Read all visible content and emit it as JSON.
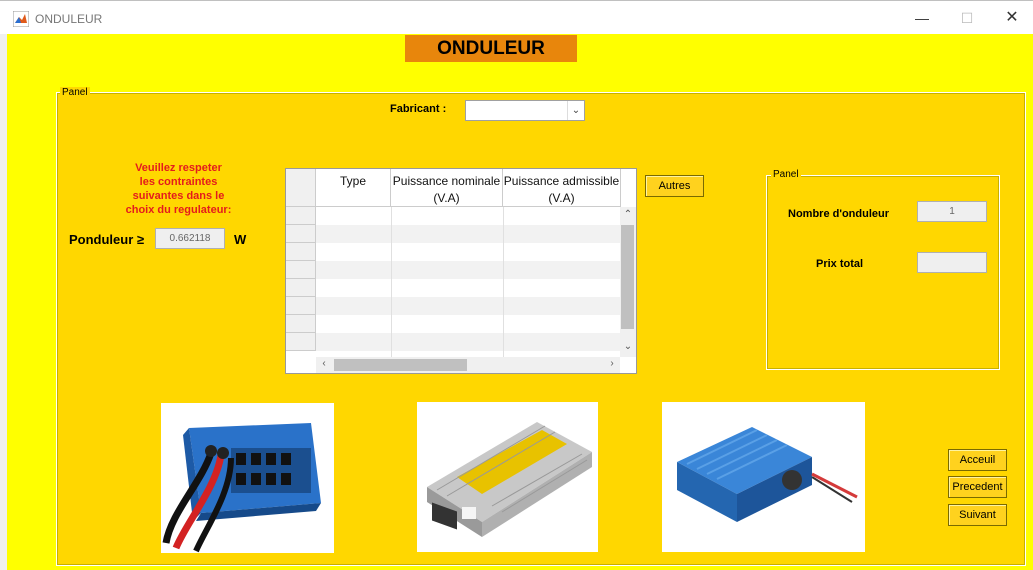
{
  "window": {
    "title": "ONDULEUR",
    "minimize": "—",
    "maximize": "☐",
    "close": "✕"
  },
  "header": {
    "title": "ONDULEUR"
  },
  "main_panel": {
    "title": "Panel"
  },
  "fabricant": {
    "label": "Fabricant :",
    "value": ""
  },
  "warning": {
    "line1": "Veuillez respeter",
    "line2": "les contraintes",
    "line3": "suivantes dans le",
    "line4": "choix du regulateur:"
  },
  "ponduleur": {
    "label": "Ponduleur ≥",
    "value": "0.662118",
    "unit": "W"
  },
  "table": {
    "columns": [
      {
        "line1": "Type",
        "line2": ""
      },
      {
        "line1": "Puissance nominale",
        "line2": "(V.A)"
      },
      {
        "line1": "Puissance admissible",
        "line2": "(V.A)"
      }
    ]
  },
  "buttons": {
    "autres": "Autres",
    "acceuil": "Acceuil",
    "precedent": "Precedent",
    "suivant": "Suivant"
  },
  "sub_panel": {
    "title": "Panel",
    "nombre_label": "Nombre d'onduleur",
    "nombre_value": "1",
    "prix_label": "Prix total",
    "prix_value": ""
  },
  "colors": {
    "background": "#ffff00",
    "panel": "#ffd700",
    "header": "#e8860c",
    "warning_text": "#e41c1c",
    "button": "#ffd21e"
  }
}
